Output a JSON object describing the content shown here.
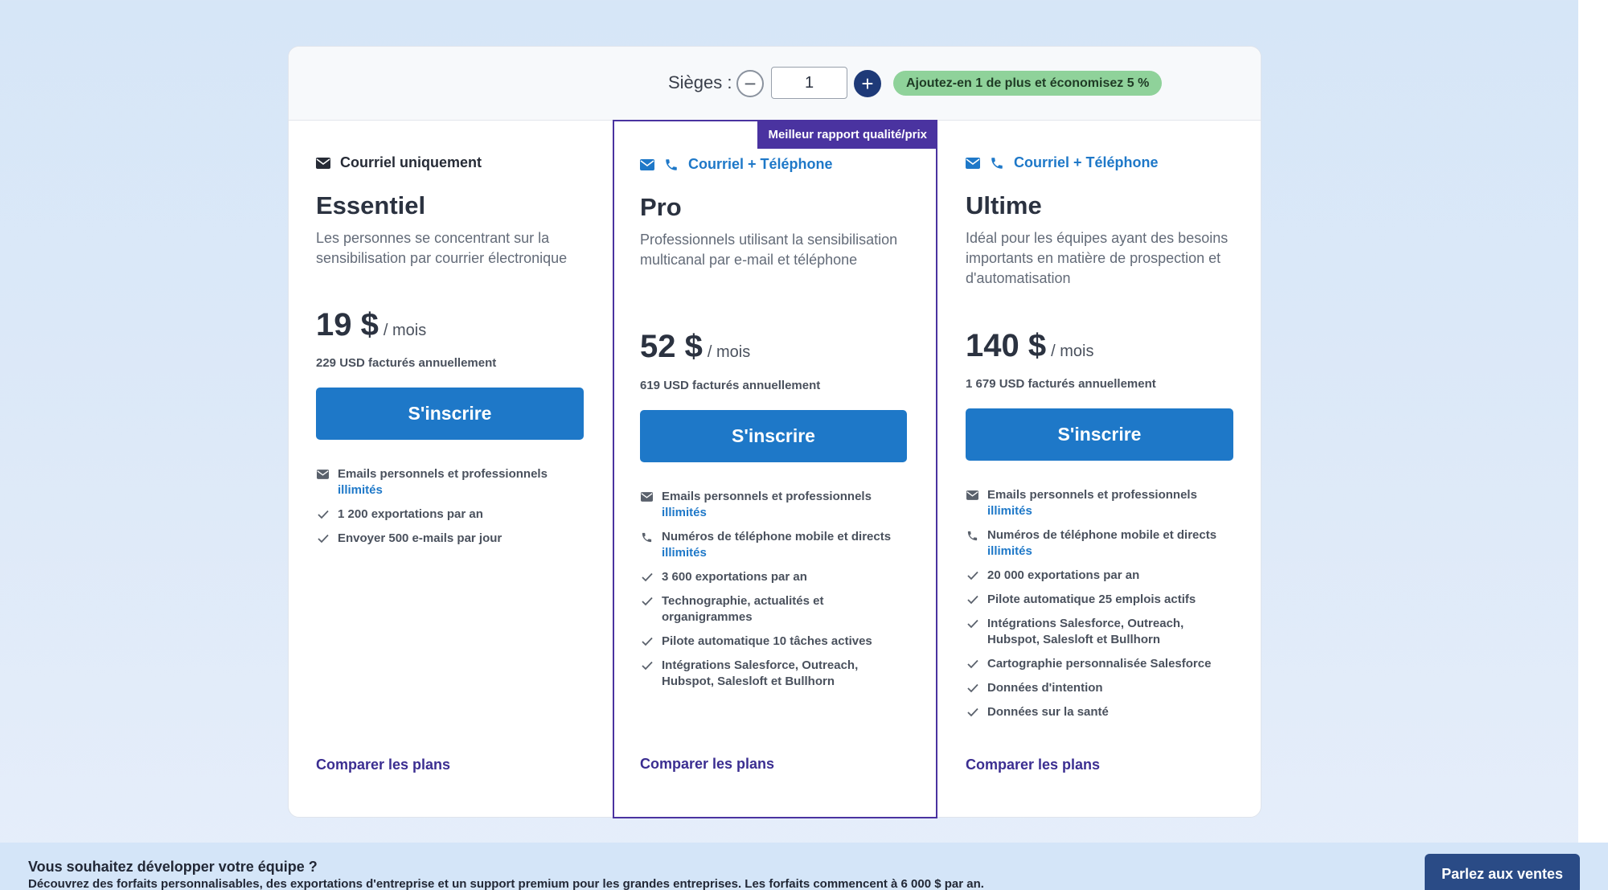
{
  "seats": {
    "label": "Sièges :",
    "value": "1",
    "minus_symbol": "−",
    "plus_symbol": "+",
    "savings_badge": "Ajoutez-en 1 de plus et économisez 5 %"
  },
  "plans": [
    {
      "channel": "Courriel uniquement",
      "name": "Essentiel",
      "description": "Les personnes se concentrant sur la sensibilisation par courrier électronique",
      "price": "19 $",
      "per": "/ mois",
      "billed": "229 USD facturés annuellement",
      "cta": "S'inscrire",
      "features": [
        {
          "icon": "mail-icon",
          "text": "Emails personnels et professionnels",
          "highlight": "illimités"
        },
        {
          "icon": "check-icon",
          "text": "1 200 exportations par an",
          "highlight": ""
        },
        {
          "icon": "check-icon",
          "text": "Envoyer 500 e-mails par jour",
          "highlight": ""
        }
      ],
      "compare": "Comparer les plans"
    },
    {
      "badge": "Meilleur rapport qualité/prix",
      "channel": "Courriel + Téléphone",
      "name": "Pro",
      "description": "Professionnels utilisant la sensibilisation multicanal par e-mail et téléphone",
      "price": "52 $",
      "per": "/ mois",
      "billed": "619 USD facturés annuellement",
      "cta": "S'inscrire",
      "features": [
        {
          "icon": "mail-icon",
          "text": "Emails personnels et professionnels",
          "highlight": "illimités"
        },
        {
          "icon": "phone-icon",
          "text": "Numéros de téléphone mobile et directs",
          "highlight": "illimités"
        },
        {
          "icon": "check-icon",
          "text": "3 600 exportations par an",
          "highlight": ""
        },
        {
          "icon": "check-icon",
          "text": "Technographie, actualités et organigrammes",
          "highlight": ""
        },
        {
          "icon": "check-icon",
          "text": "Pilote automatique 10 tâches actives",
          "highlight": ""
        },
        {
          "icon": "check-icon",
          "text": "Intégrations Salesforce, Outreach, Hubspot, Salesloft et Bullhorn",
          "highlight": ""
        }
      ],
      "compare": "Comparer les plans"
    },
    {
      "channel": "Courriel + Téléphone",
      "name": "Ultime",
      "description": "Idéal pour les équipes ayant des besoins importants en matière de prospection et d'automatisation",
      "price": "140 $",
      "per": "/ mois",
      "billed": "1 679 USD facturés annuellement",
      "cta": "S'inscrire",
      "features": [
        {
          "icon": "mail-icon",
          "text": "Emails personnels et professionnels",
          "highlight": "illimités"
        },
        {
          "icon": "phone-icon",
          "text": "Numéros de téléphone mobile et directs",
          "highlight": "illimités"
        },
        {
          "icon": "check-icon",
          "text": "20 000 exportations par an",
          "highlight": ""
        },
        {
          "icon": "check-icon",
          "text": "Pilote automatique 25 emplois actifs",
          "highlight": ""
        },
        {
          "icon": "check-icon",
          "text": "Intégrations Salesforce, Outreach, Hubspot, Salesloft et Bullhorn",
          "highlight": ""
        },
        {
          "icon": "check-icon",
          "text": "Cartographie personnalisée Salesforce",
          "highlight": ""
        },
        {
          "icon": "check-icon",
          "text": "Données d'intention",
          "highlight": ""
        },
        {
          "icon": "check-icon",
          "text": "Données sur la santé",
          "highlight": ""
        }
      ],
      "compare": "Comparer les plans"
    }
  ],
  "banner": {
    "title": "Vous souhaitez développer votre équipe ?",
    "text": "Découvrez des forfaits personnalisables, des exportations d'entreprise et un support premium pour les grandes entreprises. Les forfaits commencent à 6 000 $ par an.",
    "button": "Parlez aux ventes"
  },
  "colors": {
    "accent_blue": "#1e78c8",
    "highlight_purple": "#4a33a0",
    "savings_green": "#8fd29a",
    "sales_button": "#2a4b86"
  }
}
